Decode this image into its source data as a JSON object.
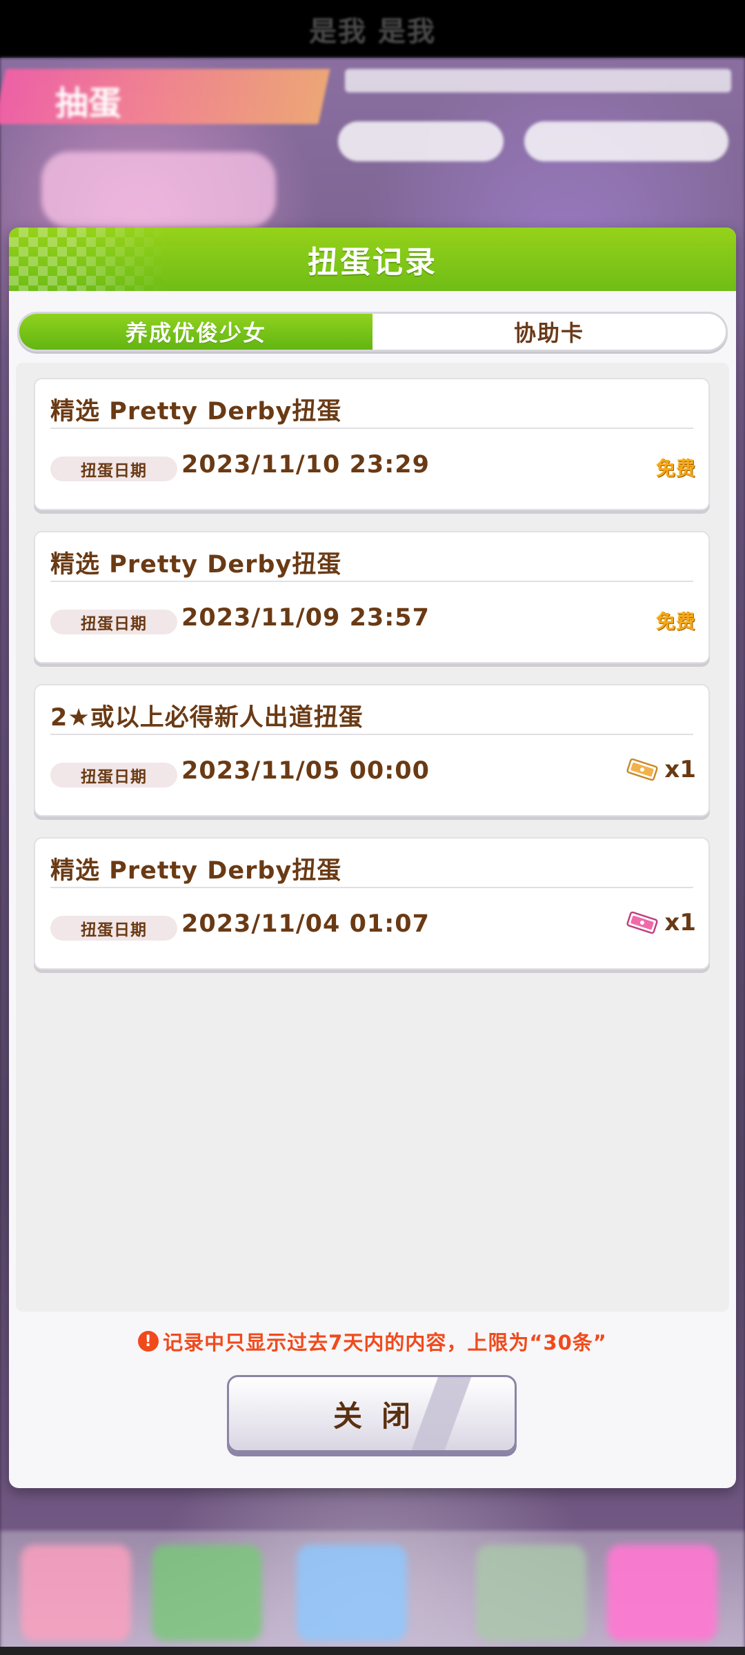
{
  "status_bar": {
    "text": "是我 是我"
  },
  "background": {
    "screen_title": "抽蛋"
  },
  "modal": {
    "title": "扭蛋记录",
    "tabs": [
      {
        "label": "养成优俊少女",
        "active": true
      },
      {
        "label": "协助卡",
        "active": false
      }
    ],
    "records": [
      {
        "title": "精选 Pretty Derby扭蛋",
        "date_label": "扭蛋日期",
        "date": "2023/11/10 23:29",
        "cost_type": "free",
        "cost_text": "免费"
      },
      {
        "title": "精选 Pretty Derby扭蛋",
        "date_label": "扭蛋日期",
        "date": "2023/11/09 23:57",
        "cost_type": "free",
        "cost_text": "免费"
      },
      {
        "title": "2★或以上必得新人出道扭蛋",
        "date_label": "扭蛋日期",
        "date": "2023/11/05 00:00",
        "cost_type": "ticket",
        "ticket_icon": "gold-ticket-icon",
        "ticket_color": "#f2b24a",
        "cost_text": "x1"
      },
      {
        "title": "精选 Pretty Derby扭蛋",
        "date_label": "扭蛋日期",
        "date": "2023/11/04 01:07",
        "cost_type": "ticket",
        "ticket_icon": "pink-ticket-icon",
        "ticket_color": "#f06aa8",
        "cost_text": "x1"
      }
    ],
    "notice": "记录中只显示过去7天内的内容，上限为“30条”",
    "close_label": "关闭"
  },
  "colors": {
    "header_green": "#7cc61a",
    "text_brown": "#6a3a14",
    "free_gold": "#f4a91a",
    "notice_red": "#f04a1c"
  }
}
